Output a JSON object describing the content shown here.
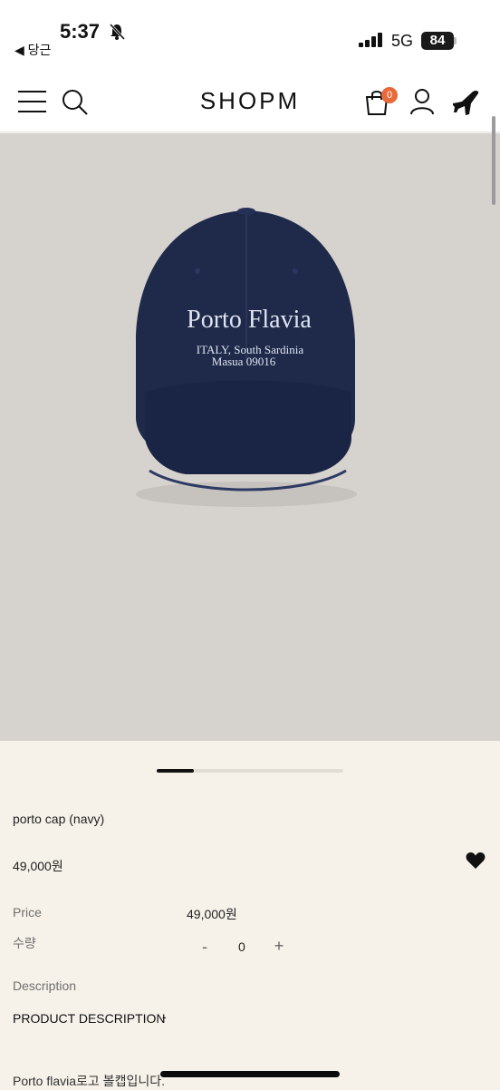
{
  "status": {
    "time": "5:37",
    "back_label": "◀ 당근",
    "network": "5G",
    "battery": "84"
  },
  "header": {
    "brand": "SHOPM",
    "cart_count": "0"
  },
  "product_image": {
    "text_line1": "Porto Flavia",
    "text_line2": "ITALY, South Sardinia",
    "text_line3": "Masua 09016",
    "slider_progress": 0.2
  },
  "product": {
    "name": "porto cap (navy)",
    "price": "49,000원"
  },
  "options": {
    "price_label": "Price",
    "price_value": "49,000원",
    "qty_label": "수량",
    "qty_minus": "-",
    "qty_value": "0",
    "qty_plus": "+"
  },
  "description": {
    "label": "Description",
    "title": "PRODUCT DESCRIPTION",
    "toggle": "-",
    "text": "Porto flavia로고 볼캡입니다."
  },
  "colors": {
    "accent": "#e8693a",
    "cap": "#1f2a4a",
    "background": "#f6f2ea"
  }
}
